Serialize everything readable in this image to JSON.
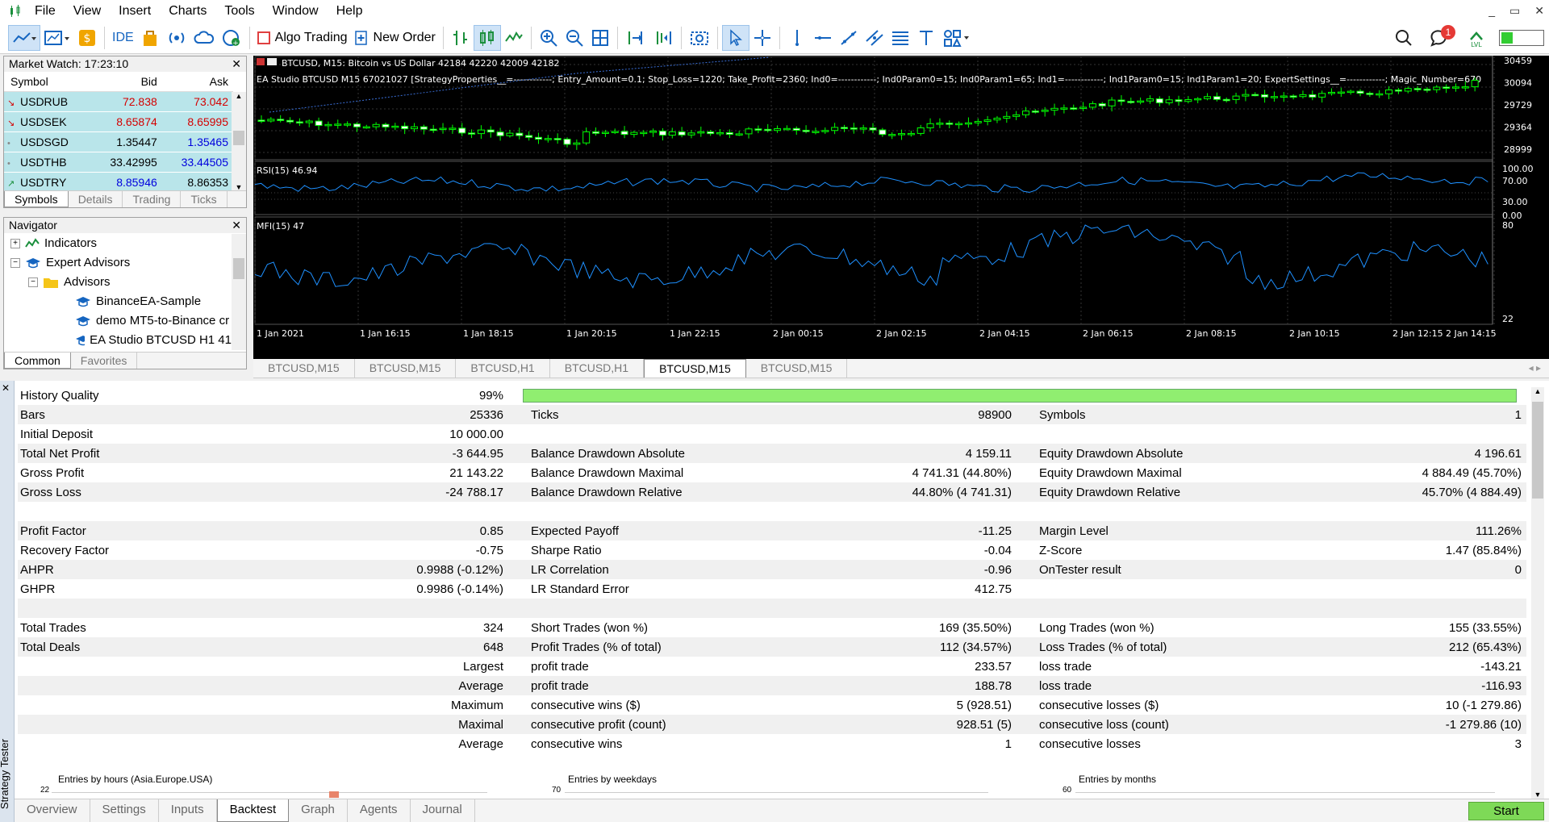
{
  "menu": {
    "items": [
      "File",
      "View",
      "Insert",
      "Charts",
      "Tools",
      "Window",
      "Help"
    ],
    "window_controls": [
      "_",
      "▭",
      "✕"
    ]
  },
  "toolbar": {
    "ide": "IDE",
    "algo_trading": "Algo Trading",
    "new_order": "New Order",
    "notification_count": "1"
  },
  "market_watch": {
    "title": "Market Watch: 17:23:10",
    "close": "✕",
    "headers": [
      "Symbol",
      "Bid",
      "Ask"
    ],
    "rows": [
      {
        "arrow": "↘",
        "symbol": "USDRUB",
        "bid": "72.838",
        "ask": "73.042",
        "bid_color": "red",
        "ask_color": "red"
      },
      {
        "arrow": "↘",
        "symbol": "USDSEK",
        "bid": "8.65874",
        "ask": "8.65995",
        "bid_color": "red",
        "ask_color": "red"
      },
      {
        "arrow": "•",
        "symbol": "USDSGD",
        "bid": "1.35447",
        "ask": "1.35465",
        "bid_color": "black",
        "ask_color": "blue"
      },
      {
        "arrow": "•",
        "symbol": "USDTHB",
        "bid": "33.42995",
        "ask": "33.44505",
        "bid_color": "black",
        "ask_color": "blue"
      },
      {
        "arrow": "↗",
        "symbol": "USDTRY",
        "bid": "8.85946",
        "ask": "8.86353",
        "bid_color": "blue",
        "ask_color": "black"
      }
    ],
    "tabs": [
      "Symbols",
      "Details",
      "Trading",
      "Ticks"
    ]
  },
  "navigator": {
    "title": "Navigator",
    "close": "✕",
    "items": [
      "Indicators",
      "Expert Advisors",
      "Advisors",
      "BinanceEA-Sample",
      "demo MT5-to-Binance cr",
      "EA Studio BTCUSD H1 41"
    ],
    "tabs": [
      "Common",
      "Favorites"
    ]
  },
  "chart": {
    "header": "BTCUSD, M15:  Bitcoin vs US Dollar  42184 42220 42009 42182",
    "ea_line": "EA Studio BTCUSD M15 67021027 [StrategyProperties__=------------; Entry_Amount=0.1; Stop_Loss=1220; Take_Profit=2360; Ind0=------------; Ind0Param0=15; Ind0Param1=65; Ind1=------------; Ind1Param0=15; Ind1Param1=20; ExpertSettings__=------------; Magic_Number=670",
    "price_ticks": [
      "30459",
      "30094",
      "29729",
      "29364",
      "28999"
    ],
    "rsi_label": "RSI(15) 46.94",
    "rsi_ticks": [
      "100.00",
      "70.00",
      "30.00",
      "0.00"
    ],
    "mfi_label": "MFI(15) 47",
    "mfi_ticks": [
      "80",
      "22"
    ],
    "time_ticks": [
      "1 Jan 2021",
      "1 Jan 16:15",
      "1 Jan 18:15",
      "1 Jan 20:15",
      "1 Jan 22:15",
      "2 Jan 00:15",
      "2 Jan 02:15",
      "2 Jan 04:15",
      "2 Jan 06:15",
      "2 Jan 08:15",
      "2 Jan 10:15",
      "2 Jan 12:15",
      "2 Jan 14:15"
    ],
    "colors": {
      "bull": "#00ff00",
      "bear": "#ffffff",
      "indicator": "#1e90ff"
    }
  },
  "chart_tabs": [
    "BTCUSD,M15",
    "BTCUSD,M15",
    "BTCUSD,H1",
    "BTCUSD,H1",
    "BTCUSD,M15",
    "BTCUSD,M15"
  ],
  "chart_tabs_active": 4,
  "tester": {
    "side_label": "Strategy Tester",
    "history_quality_label": "History Quality",
    "history_quality": "99%",
    "rows": [
      [
        "Bars",
        "25336",
        "Ticks",
        "98900",
        "Symbols",
        "1"
      ],
      [
        "Initial Deposit",
        "10 000.00",
        "",
        "",
        "",
        ""
      ],
      [
        "Total Net Profit",
        "-3 644.95",
        "Balance Drawdown Absolute",
        "4 159.11",
        "Equity Drawdown Absolute",
        "4 196.61"
      ],
      [
        "Gross Profit",
        "21 143.22",
        "Balance Drawdown Maximal",
        "4 741.31 (44.80%)",
        "Equity Drawdown Maximal",
        "4 884.49 (45.70%)"
      ],
      [
        "Gross Loss",
        "-24 788.17",
        "Balance Drawdown Relative",
        "44.80% (4 741.31)",
        "Equity Drawdown Relative",
        "45.70% (4 884.49)"
      ],
      [
        "",
        "",
        "",
        "",
        "",
        ""
      ],
      [
        "Profit Factor",
        "0.85",
        "Expected Payoff",
        "-11.25",
        "Margin Level",
        "111.26%"
      ],
      [
        "Recovery Factor",
        "-0.75",
        "Sharpe Ratio",
        "-0.04",
        "Z-Score",
        "1.47 (85.84%)"
      ],
      [
        "AHPR",
        "0.9988 (-0.12%)",
        "LR Correlation",
        "-0.96",
        "OnTester result",
        "0"
      ],
      [
        "GHPR",
        "0.9986 (-0.14%)",
        "LR Standard Error",
        "412.75",
        "",
        ""
      ],
      [
        "",
        "",
        "",
        "",
        "",
        ""
      ],
      [
        "Total Trades",
        "324",
        "Short Trades (won %)",
        "169 (35.50%)",
        "Long Trades (won %)",
        "155 (33.55%)"
      ],
      [
        "Total Deals",
        "648",
        "Profit Trades (% of total)",
        "112 (34.57%)",
        "Loss Trades (% of total)",
        "212 (65.43%)"
      ],
      [
        "",
        "Largest",
        "profit trade",
        "233.57",
        "loss trade",
        "-143.21"
      ],
      [
        "",
        "Average",
        "profit trade",
        "188.78",
        "loss trade",
        "-116.93"
      ],
      [
        "",
        "Maximum",
        "consecutive wins ($)",
        "5 (928.51)",
        "consecutive losses ($)",
        "10 (-1 279.86)"
      ],
      [
        "",
        "Maximal",
        "consecutive profit (count)",
        "928.51 (5)",
        "consecutive loss (count)",
        "-1 279.86 (10)"
      ],
      [
        "",
        "Average",
        "consecutive wins",
        "1",
        "consecutive losses",
        "3"
      ]
    ],
    "hist1_title": "Entries by hours (Asia.Europe.USA)",
    "hist1_tick": "22",
    "hist2_title": "Entries by weekdays",
    "hist2_tick": "70",
    "hist3_title": "Entries by months",
    "hist3_tick": "60",
    "tabs": [
      "Overview",
      "Settings",
      "Inputs",
      "Backtest",
      "Graph",
      "Agents",
      "Journal"
    ],
    "active_tab": 3,
    "start": "Start"
  }
}
